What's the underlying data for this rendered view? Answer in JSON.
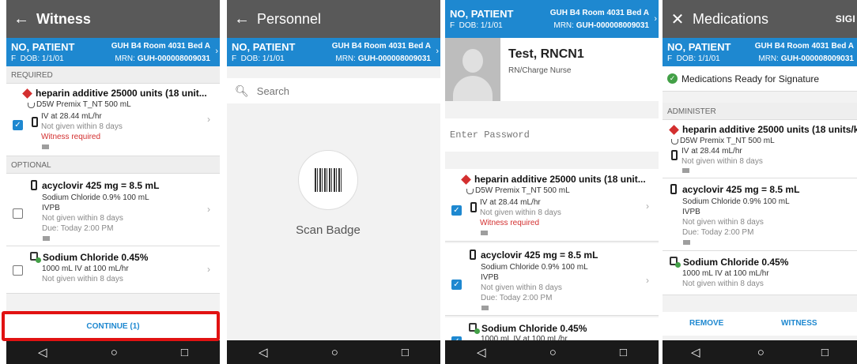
{
  "patient": {
    "name": "NO, PATIENT",
    "sex": "F",
    "dob": "DOB: 1/1/01",
    "location": "GUH B4 Room 4031 Bed A",
    "mrn_label": "MRN: ",
    "mrn": "GUH-000008009031"
  },
  "screen1": {
    "title": "Witness",
    "required_header": "REQUIRED",
    "optional_header": "OPTIONAL",
    "continue_label": "CONTINUE (1)"
  },
  "screen2": {
    "title": "Personnel",
    "search_placeholder": "Search",
    "scan_label": "Scan Badge"
  },
  "screen3": {
    "user_name": "Test, RNCN1",
    "user_role": "RN/Charge Nurse",
    "password_placeholder": "Enter Password"
  },
  "screen4": {
    "title": "Medications",
    "sign_label": "SIGI",
    "ready_text": "Medications Ready for Signature",
    "administer_header": "ADMINISTER",
    "remove_label": "REMOVE",
    "witness_label": "WITNESS"
  },
  "meds": {
    "heparin": {
      "title": "heparin additive 25000 units (18 unit...",
      "title_long": "heparin additive 25000 units (18 units/k...",
      "product": "D5W Premix T_NT 500 mL",
      "rate": "IV at 28.44 mL/hr",
      "status": "Not given within 8 days",
      "witness": "Witness required"
    },
    "acyclovir": {
      "title": "acyclovir 425 mg = 8.5 mL",
      "diluent": "Sodium Chloride 0.9% 100 mL",
      "route": "IVPB",
      "status": "Not given within 8 days",
      "due": "Due: Today 2:00 PM"
    },
    "sodium": {
      "title": "Sodium Chloride 0.45%",
      "rate": "1000 mL IV at 100 mL/hr",
      "rate_cut": "1000 mL IV at 100 mL/hr",
      "status": "Not given within 8 days"
    }
  },
  "icons": {
    "back": "arrow-left-icon",
    "close": "close-icon",
    "chevron": "chevron-right-icon",
    "search": "search-icon",
    "nav_back": "triangle-back-icon",
    "nav_home": "circle-home-icon",
    "nav_recent": "square-recent-icon"
  },
  "colors": {
    "appbar": "#595959",
    "patient_bar": "#1e88d0",
    "accent": "#1e88d0",
    "alert": "#d32f2f",
    "ok": "#43a047",
    "highlight": "#e11212"
  }
}
